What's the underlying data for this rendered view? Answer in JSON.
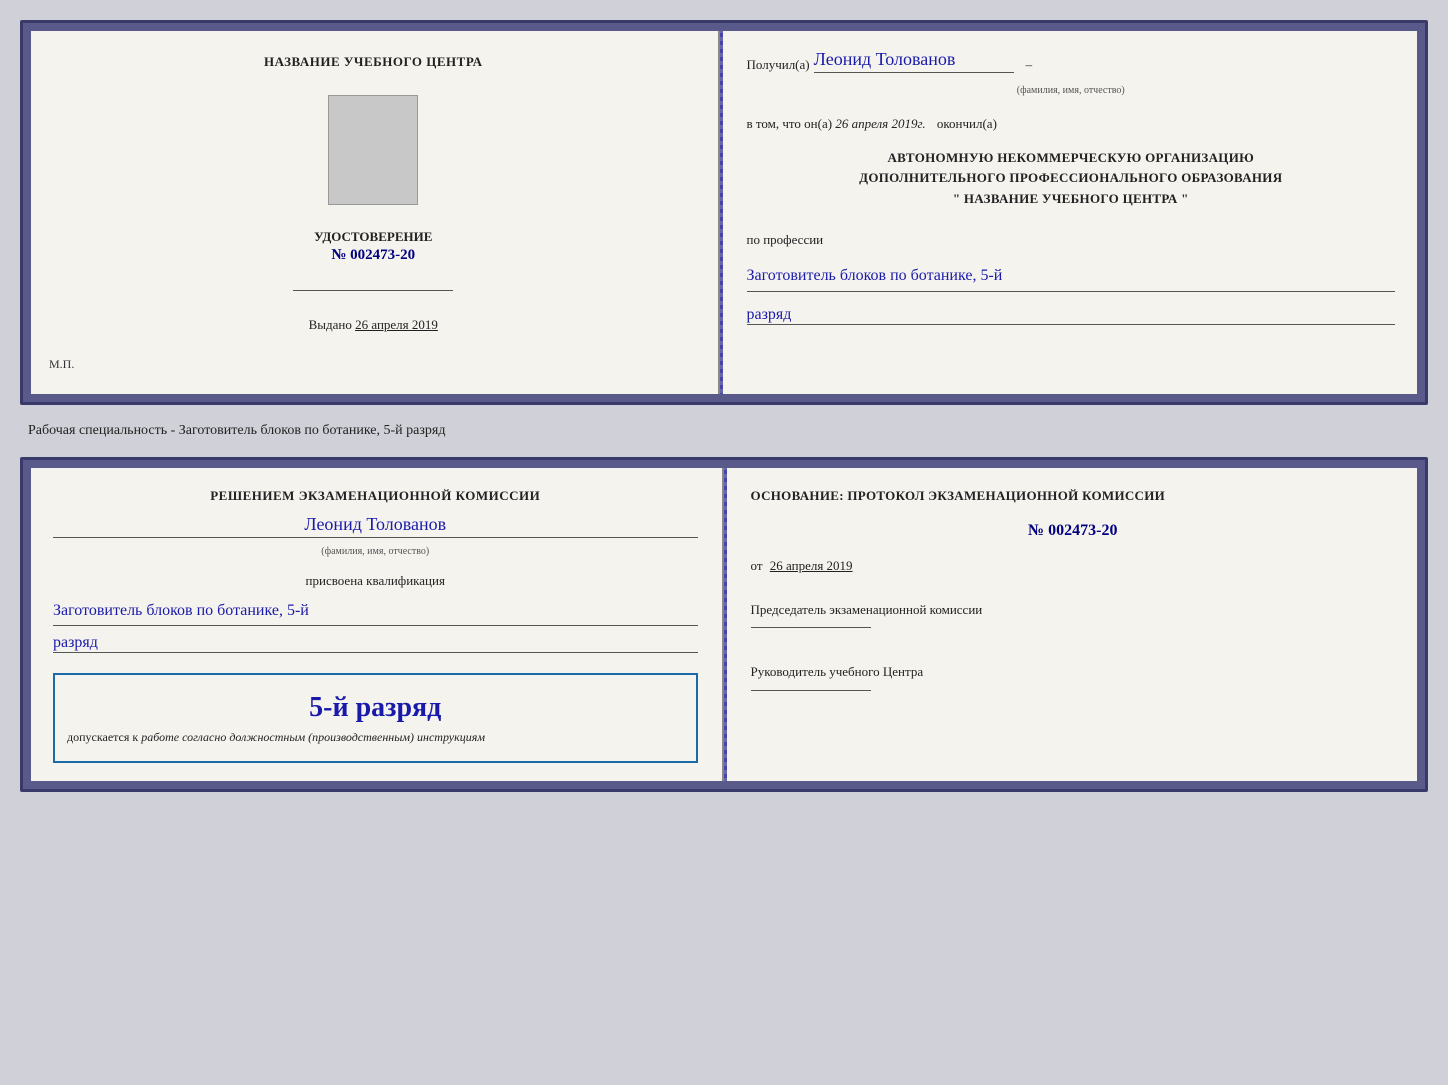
{
  "page": {
    "background": "#d0d0d8"
  },
  "specialty_description": "Рабочая специальность - Заготовитель блоков по ботанике, 5-й разряд",
  "document1": {
    "left": {
      "training_center_label": "НАЗВАНИЕ УЧЕБНОГО ЦЕНТРА",
      "udostoverenie": "УДОСТОВЕРЕНИЕ",
      "number": "№ 002473-20",
      "issued_label": "Выдано",
      "issued_date": "26 апреля 2019",
      "mp_label": "М.П."
    },
    "right": {
      "received_prefix": "Получил(а)",
      "recipient_name": "Леонид Толованов",
      "fio_label": "(фамилия, имя, отчество)",
      "statement_prefix": "в том, что он(а)",
      "statement_date": "26 апреля 2019г.",
      "statement_suffix": "окончил(а)",
      "org_line1": "АВТОНОМНУЮ НЕКОММЕРЧЕСКУЮ ОРГАНИЗАЦИЮ",
      "org_line2": "ДОПОЛНИТЕЛЬНОГО ПРОФЕССИОНАЛЬНОГО ОБРАЗОВАНИЯ",
      "org_line3": "\"  НАЗВАНИЕ УЧЕБНОГО ЦЕНТРА  \"",
      "profession_label": "по профессии",
      "profession_value": "Заготовитель блоков по ботанике, 5-й",
      "rank_value": "разряд"
    }
  },
  "document2": {
    "left": {
      "decision_text": "Решением экзаменационной комиссии",
      "name": "Леонид Толованов",
      "fio_label": "(фамилия, имя, отчество)",
      "assigned_label": "присвоена квалификация",
      "profession_value": "Заготовитель блоков по ботанике, 5-й",
      "rank_value": "разряд",
      "stamp_rank": "5-й разряд",
      "stamp_допускается": "допускается к",
      "stamp_italic": "работе согласно должностным (производственным) инструкциям"
    },
    "right": {
      "basis_label": "Основание: протокол экзаменационной комиссии",
      "protocol_number": "№ 002473-20",
      "date_prefix": "от",
      "date_value": "26 апреля 2019",
      "chairman_label": "Председатель экзаменационной комиссии",
      "director_label": "Руководитель учебного Центра"
    }
  }
}
